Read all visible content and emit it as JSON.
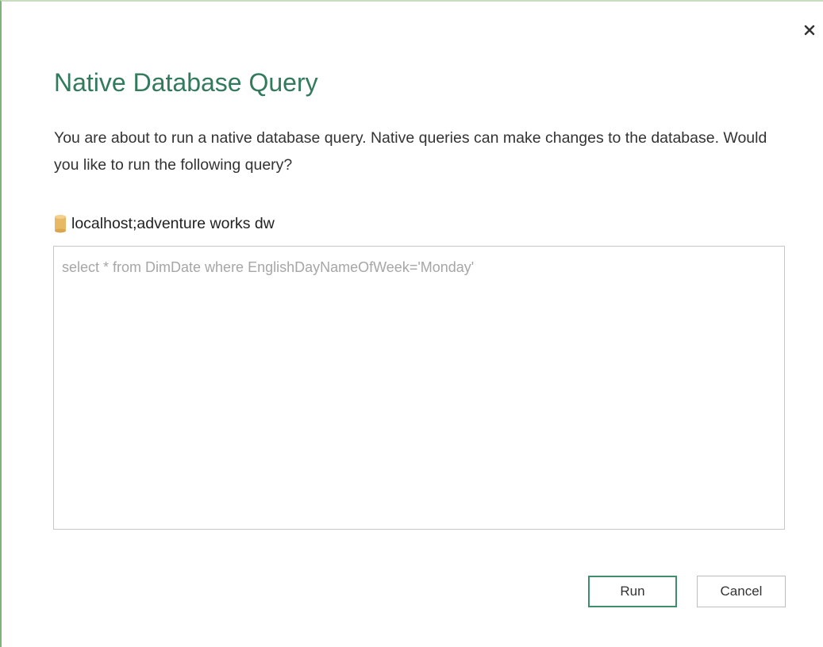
{
  "dialog": {
    "title": "Native Database Query",
    "description": "You are about to run a native database query. Native queries can make changes to the database. Would you like to run the following query?",
    "close_icon": "close-icon"
  },
  "source": {
    "icon": "database-icon",
    "label": "localhost;adventure works dw"
  },
  "query": {
    "text": "select * from DimDate where EnglishDayNameOfWeek='Monday'"
  },
  "buttons": {
    "run_label": "Run",
    "cancel_label": "Cancel"
  },
  "colors": {
    "title": "#317a5b",
    "accent_border": "#3f8d6b",
    "db_icon": "#e8b964"
  }
}
